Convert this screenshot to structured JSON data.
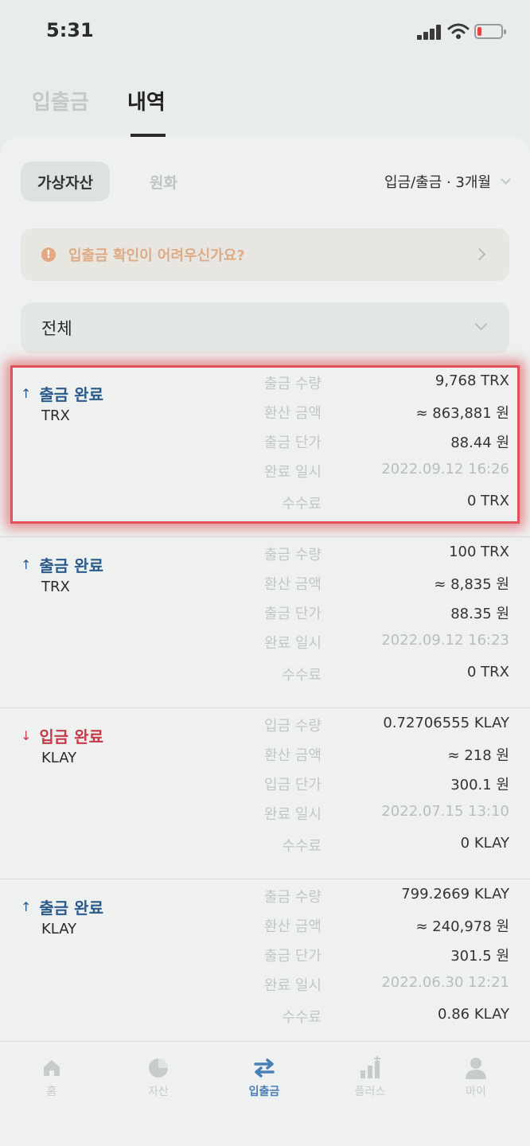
{
  "status_bar": {
    "time": "5:31"
  },
  "top_tabs": [
    {
      "label": "입출금"
    },
    {
      "label": "내역"
    }
  ],
  "filters": {
    "segment_active": "가상자산",
    "segment_inactive": "원화",
    "period": "입금/출금 · 3개월"
  },
  "notice": {
    "text": "입출금 확인이 어려우신가요?"
  },
  "asset_filter": {
    "selected": "전체"
  },
  "transactions": [
    {
      "status": "출금 완료",
      "coin": "TRX",
      "rows": [
        {
          "label": "출금 수량",
          "value": "9,768 TRX"
        },
        {
          "label": "환산 금액",
          "value": "≈ 863,881 원"
        },
        {
          "label": "출금 단가",
          "value": "88.44 원"
        },
        {
          "label": "완료 일시",
          "value": "2022.09.12 16:26"
        },
        {
          "label": "수수료",
          "value": "0 TRX"
        }
      ]
    },
    {
      "status": "출금 완료",
      "coin": "TRX",
      "rows": [
        {
          "label": "출금 수량",
          "value": "100 TRX"
        },
        {
          "label": "환산 금액",
          "value": "≈ 8,835 원"
        },
        {
          "label": "출금 단가",
          "value": "88.35 원"
        },
        {
          "label": "완료 일시",
          "value": "2022.09.12 16:23"
        },
        {
          "label": "수수료",
          "value": "0 TRX"
        }
      ]
    },
    {
      "status": "입금 완료",
      "coin": "KLAY",
      "rows": [
        {
          "label": "입금 수량",
          "value": "0.72706555 KLAY"
        },
        {
          "label": "환산 금액",
          "value": "≈ 218 원"
        },
        {
          "label": "입금 단가",
          "value": "300.1 원"
        },
        {
          "label": "완료 일시",
          "value": "2022.07.15 13:10"
        },
        {
          "label": "수수료",
          "value": "0 KLAY"
        }
      ]
    },
    {
      "status": "출금 완료",
      "coin": "KLAY",
      "rows": [
        {
          "label": "출금 수량",
          "value": "799.2669 KLAY"
        },
        {
          "label": "환산 금액",
          "value": "≈ 240,978 원"
        },
        {
          "label": "출금 단가",
          "value": "301.5 원"
        },
        {
          "label": "완료 일시",
          "value": "2022.06.30 12:21"
        },
        {
          "label": "수수료",
          "value": "0.86 KLAY"
        }
      ]
    }
  ],
  "bottom_nav": [
    {
      "label": "홈",
      "icon": "home-icon"
    },
    {
      "label": "자산",
      "icon": "pie-chart-icon"
    },
    {
      "label": "입출금",
      "icon": "transfer-arrows-icon"
    },
    {
      "label": "플러스",
      "icon": "bar-chart-plus-icon"
    },
    {
      "label": "마이",
      "icon": "user-icon"
    }
  ],
  "colors": {
    "withdraw": "#2b5b8a",
    "deposit": "#c43a49",
    "highlight": "#e2505a",
    "nav_active": "#4a7fb8"
  }
}
